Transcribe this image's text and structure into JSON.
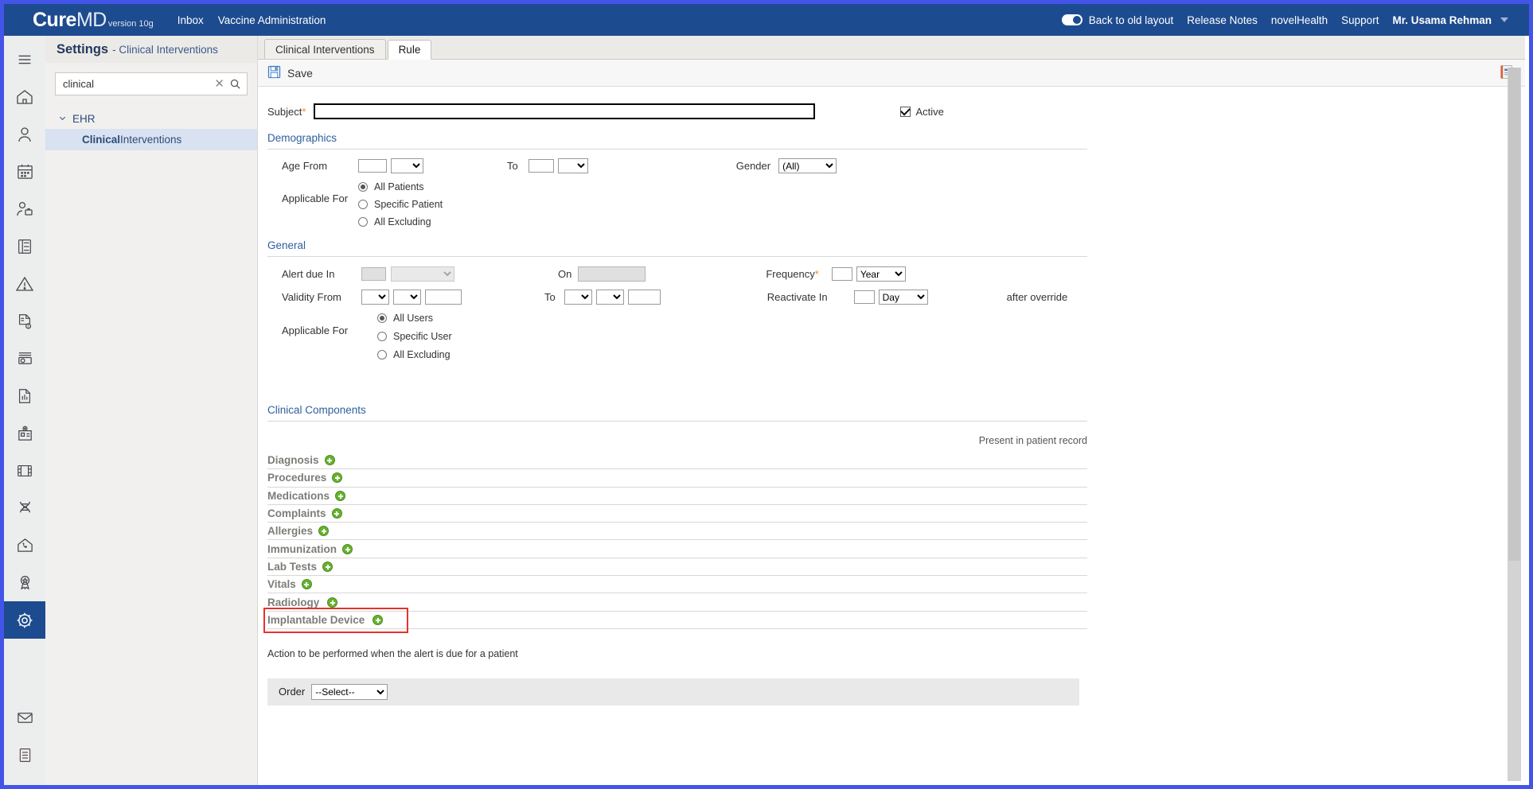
{
  "topbar": {
    "logo_primary": "Cure",
    "logo_secondary": "MD",
    "logo_version": "version 10g",
    "nav_left": [
      "Inbox",
      "Vaccine Administration"
    ],
    "toggle_label": "Back to old layout",
    "nav_right": [
      "Release Notes",
      "novelHealth",
      "Support"
    ],
    "user_name": "Mr. Usama Rehman",
    "bg_color": "#1d4b8f"
  },
  "rail": {
    "items": [
      {
        "icon": "hamburger-menu-icon",
        "active": false
      },
      {
        "icon": "home-icon",
        "active": false
      },
      {
        "icon": "person-icon",
        "active": false
      },
      {
        "icon": "calendar-icon",
        "active": false
      },
      {
        "icon": "person-briefcase-icon",
        "active": false
      },
      {
        "icon": "file-cabinet-icon",
        "active": false
      },
      {
        "icon": "warning-triangle-icon",
        "active": false
      },
      {
        "icon": "billing-document-icon",
        "active": false
      },
      {
        "icon": "cash-money-icon",
        "active": false
      },
      {
        "icon": "report-chart-icon",
        "active": false
      },
      {
        "icon": "clinic-building-icon",
        "active": false
      },
      {
        "icon": "media-film-icon",
        "active": false
      },
      {
        "icon": "dna-icon",
        "active": false
      },
      {
        "icon": "telehealth-home-phone-icon",
        "active": false
      },
      {
        "icon": "award-ribbon-icon",
        "active": false
      },
      {
        "icon": "gear-settings-icon",
        "active": true
      }
    ],
    "bottom_items": [
      {
        "icon": "envelope-mail-icon"
      },
      {
        "icon": "notes-document-icon"
      }
    ],
    "active_color": "#1d4b8f"
  },
  "settings_panel": {
    "title": "Settings",
    "subtitle": "- Clinical Interventions",
    "search": {
      "value": "clinical",
      "placeholder": "Search"
    },
    "tree": {
      "group_label": "EHR",
      "leaf_bold": "Clinical",
      "leaf_rest": " Interventions"
    }
  },
  "tabs": [
    {
      "label": "Clinical Interventions",
      "active": false
    },
    {
      "label": "Rule",
      "active": true
    }
  ],
  "toolbar": {
    "save_label": "Save",
    "save_icon": "floppy-disk-save-icon",
    "notes_icon": "notepad-icon"
  },
  "form": {
    "subject": {
      "label": "Subject",
      "required_mark": "*",
      "value": ""
    },
    "active": {
      "label": "Active",
      "checked": true
    },
    "demographics": {
      "section_title": "Demographics",
      "age_from_label": "Age From",
      "age_from_value": "",
      "age_from_unit": "",
      "to_label": "To",
      "age_to_value": "",
      "age_to_unit": "",
      "gender_label": "Gender",
      "gender_value": "(All)",
      "applicable_label": "Applicable For",
      "radios": [
        {
          "label": "All Patients",
          "selected": true
        },
        {
          "label": "Specific Patient",
          "selected": false
        },
        {
          "label": "All Excluding",
          "selected": false
        }
      ]
    },
    "general": {
      "section_title": "General",
      "alert_due_in_label": "Alert due In",
      "alert_due_in_value": "",
      "alert_due_in_unit": "",
      "on_label": "On",
      "on_value": "",
      "frequency_label": "Frequency",
      "frequency_required": "*",
      "frequency_value": "",
      "frequency_unit": "Year",
      "validity_from_label": "Validity From",
      "validity_from_m": "",
      "validity_from_d": "",
      "validity_from_y": "",
      "validity_to_label": "To",
      "validity_to_m": "",
      "validity_to_d": "",
      "validity_to_y": "",
      "reactivate_label": "Reactivate In",
      "reactivate_value": "",
      "reactivate_unit": "Day",
      "after_override_label": "after override",
      "applicable_label": "Applicable For",
      "radios": [
        {
          "label": "All Users",
          "selected": true
        },
        {
          "label": "Specific User",
          "selected": false
        },
        {
          "label": "All Excluding",
          "selected": false
        }
      ]
    },
    "clinical_components": {
      "section_title": "Clinical Components",
      "present_label": "Present in patient record",
      "rows": [
        {
          "label": "Diagnosis",
          "highlighted": false
        },
        {
          "label": "Procedures",
          "highlighted": false
        },
        {
          "label": "Medications",
          "highlighted": false
        },
        {
          "label": "Complaints",
          "highlighted": false
        },
        {
          "label": "Allergies",
          "highlighted": false
        },
        {
          "label": "Immunization",
          "highlighted": false
        },
        {
          "label": "Lab Tests",
          "highlighted": false
        },
        {
          "label": "Vitals",
          "highlighted": false
        },
        {
          "label": "Radiology",
          "highlighted": false
        },
        {
          "label": "Implantable Device",
          "highlighted": true
        }
      ],
      "highlight_color": "#e8322a"
    },
    "action": {
      "description": "Action to be performed when the alert is due for a patient",
      "order_label": "Order",
      "order_value": "--Select--"
    }
  }
}
